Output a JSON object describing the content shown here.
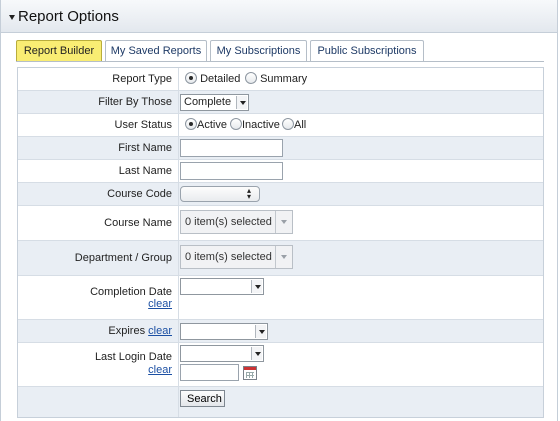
{
  "header": {
    "title": "Report Options"
  },
  "tabs": [
    {
      "label": "Report Builder",
      "active": true
    },
    {
      "label": "My Saved Reports",
      "active": false
    },
    {
      "label": "My Subscriptions",
      "active": false
    },
    {
      "label": "Public Subscriptions",
      "active": false
    }
  ],
  "form": {
    "report_type": {
      "label": "Report Type",
      "options": [
        "Detailed",
        "Summary"
      ],
      "selected": "Detailed"
    },
    "filter_by": {
      "label": "Filter By Those",
      "value": "Complete"
    },
    "user_status": {
      "label": "User Status",
      "options": [
        "Active",
        "Inactive",
        "All"
      ],
      "selected": "Active"
    },
    "first_name": {
      "label": "First Name",
      "value": ""
    },
    "last_name": {
      "label": "Last Name",
      "value": ""
    },
    "course_code": {
      "label": "Course Code",
      "value": ""
    },
    "course_name": {
      "label": "Course Name",
      "value": "0 item(s) selected"
    },
    "department": {
      "label": "Department / Group",
      "value": "0 item(s) selected"
    },
    "completion_date": {
      "label": "Completion Date",
      "clear": "clear",
      "value": ""
    },
    "expires": {
      "label": "Expires",
      "clear": "clear",
      "value": ""
    },
    "last_login": {
      "label": "Last Login Date",
      "clear": "clear",
      "value": "",
      "date_value": ""
    },
    "search_label": "Search"
  },
  "colors": {
    "active_tab": "#f9ed73",
    "alt_row": "#e9eef4",
    "link": "#1b4fa3"
  },
  "icons": {
    "collapse": "triangle-down-icon",
    "calendar": "calendar-icon"
  }
}
